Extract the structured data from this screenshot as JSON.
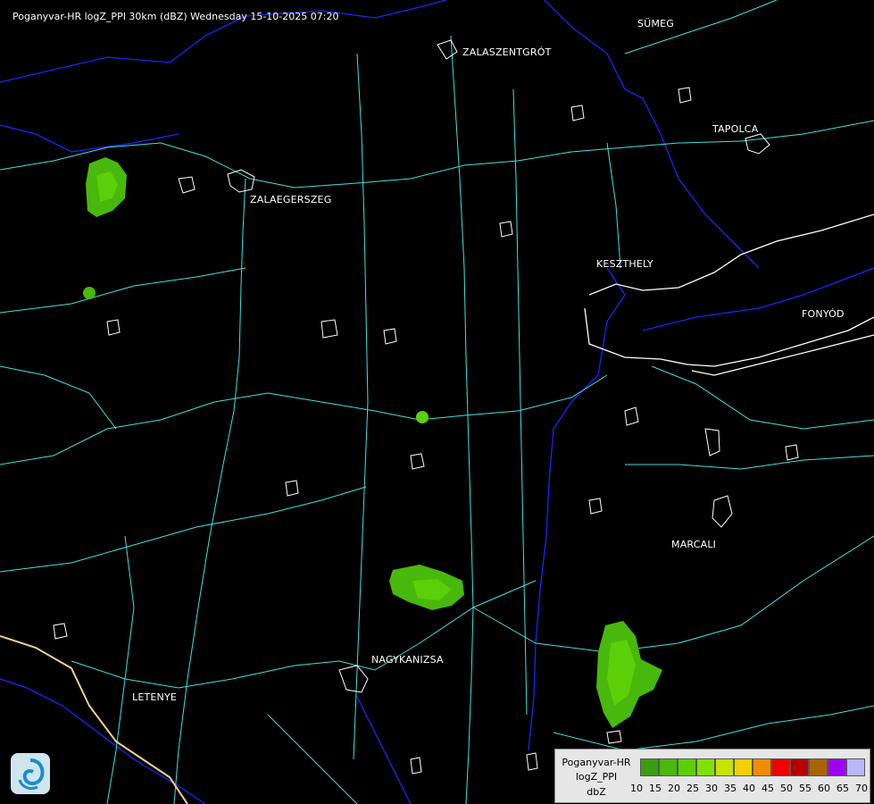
{
  "header": {
    "title": "Poganyvar-HR logZ_PPI 30km (dBZ) Wednesday 15-10-2025 07:20"
  },
  "cities": [
    {
      "name": "SÜMEG"
    },
    {
      "name": "ZALASZENTGRÓT"
    },
    {
      "name": "TAPOLCA"
    },
    {
      "name": "ZALAEGERSZEG"
    },
    {
      "name": "KESZTHELY"
    },
    {
      "name": "FONYÓD"
    },
    {
      "name": "MARCALI"
    },
    {
      "name": "NAGYKANIZSA"
    },
    {
      "name": "LETENYE"
    }
  ],
  "legend": {
    "line1": "Poganyvar-HR",
    "line2": "logZ_PPI",
    "line3": "dbZ",
    "colors": [
      "#3a9e10",
      "#48b80c",
      "#5ccf08",
      "#7fe200",
      "#c6e400",
      "#f3cf00",
      "#f08c00",
      "#f00000",
      "#b80000",
      "#a86400",
      "#a000f0",
      "#b8b8f8"
    ],
    "ticks": [
      "10",
      "15",
      "20",
      "25",
      "30",
      "35",
      "40",
      "45",
      "50",
      "55",
      "60",
      "65",
      "70"
    ]
  },
  "colors": {
    "river": "#1428ff",
    "road": "#40e0e0",
    "boundary": "#ffffff",
    "lake_shore": "#ffffff",
    "border": "#f0d090"
  }
}
